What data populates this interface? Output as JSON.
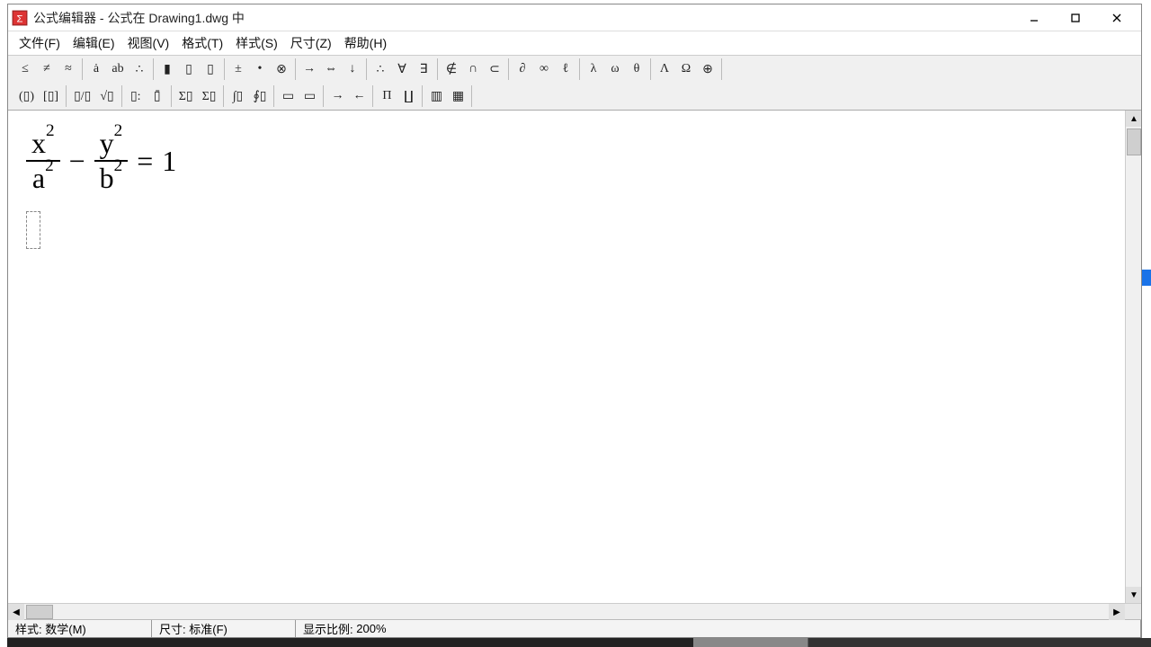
{
  "title": "公式编辑器 - 公式在 Drawing1.dwg 中",
  "menus": {
    "file": "文件(F)",
    "edit": "编辑(E)",
    "view": "视图(V)",
    "format": "格式(T)",
    "style": "样式(S)",
    "size": "尺寸(Z)",
    "help": "帮助(H)"
  },
  "toolbar_row1": [
    [
      "≤",
      "≠",
      "≈"
    ],
    [
      "ȧ",
      "ab",
      "∴"
    ],
    [
      "▮",
      "▯",
      "▯"
    ],
    [
      "±",
      "•",
      "⊗"
    ],
    [
      "→",
      "⇔",
      "↓"
    ],
    [
      "∴",
      "∀",
      "∃"
    ],
    [
      "∉",
      "∩",
      "⊂"
    ],
    [
      "∂",
      "∞",
      "ℓ"
    ],
    [
      "λ",
      "ω",
      "θ"
    ],
    [
      "Λ",
      "Ω",
      "⊕"
    ]
  ],
  "toolbar_row2": [
    [
      "(▯)",
      "[▯]"
    ],
    [
      "▯/▯",
      "√▯"
    ],
    [
      "▯:",
      "▯̄"
    ],
    [
      "Σ▯",
      "Σ▯"
    ],
    [
      "∫▯",
      "∮▯"
    ],
    [
      "▭",
      "▭"
    ],
    [
      "→",
      "←"
    ],
    [
      "Π",
      "∐"
    ],
    [
      "▥",
      "▦"
    ]
  ],
  "statusbar": {
    "style_label": "样式:",
    "style_value": "数学(M)",
    "size_label": "尺寸:",
    "size_value": "标准(F)",
    "zoom_label": "显示比例:",
    "zoom_value": "200%"
  },
  "equation": {
    "term1_num_base": "x",
    "term1_num_exp": "2",
    "term1_den_base": "a",
    "term1_den_exp": "2",
    "minus": "−",
    "term2_num_base": "y",
    "term2_num_exp": "2",
    "term2_den_base": "b",
    "term2_den_exp": "2",
    "equals": "=",
    "rhs": "1"
  }
}
